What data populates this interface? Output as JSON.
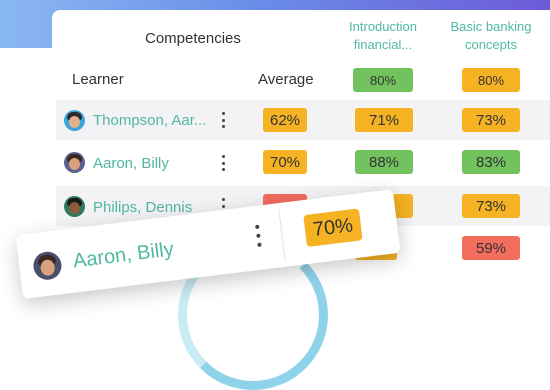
{
  "header": {
    "competencies_label": "Competencies",
    "courses": [
      {
        "line1": "Introduction",
        "line2": "financial..."
      },
      {
        "line1": "Basic banking",
        "line2": "concepts"
      }
    ],
    "course_summary": [
      "80%",
      "80%"
    ],
    "learner_label": "Learner",
    "average_label": "Average"
  },
  "rows": [
    {
      "name": "Thompson, Aar...",
      "average": "62%",
      "scores": [
        "71%",
        "73%"
      ],
      "average_color": "amber",
      "score_colors": [
        "amber",
        "amber"
      ]
    },
    {
      "name": "Aaron, Billy",
      "average": "70%",
      "scores": [
        "88%",
        "83%"
      ],
      "average_color": "amber",
      "score_colors": [
        "green",
        "green"
      ]
    },
    {
      "name": "Philips, Dennis",
      "average": "",
      "scores": [
        "",
        "73%"
      ],
      "average_color": "red",
      "score_colors": [
        "amber",
        "amber"
      ]
    },
    {
      "name": "",
      "average": "",
      "scores": [
        "",
        "59%"
      ],
      "average_color": "",
      "score_colors": [
        "amber",
        "red"
      ]
    }
  ],
  "popup": {
    "name": "Aaron, Billy",
    "average": "70%"
  },
  "colors": {
    "accent_text": "#4fb89f",
    "amber": "#f5b324",
    "green": "#72c25e",
    "red": "#f16d5c"
  }
}
